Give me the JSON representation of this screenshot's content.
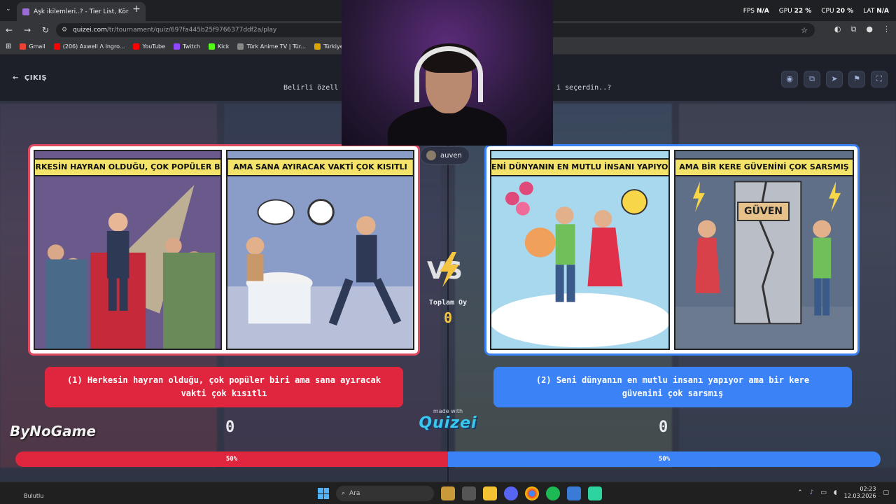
{
  "browser": {
    "tab_title": "Aşk ikilemleri..? - Tier List, Kör S",
    "tab_close": "✕",
    "new_tab": "+",
    "url_host": "quizei.com",
    "url_path": "/tr/tournament/quiz/697fa445b25f9766377ddf2a/play",
    "bookmarks": [
      "Gmail",
      "(206) Axwell Λ Ingro...",
      "YouTube",
      "Twitch",
      "Kick",
      "Türk Anime TV | Tür...",
      "Türkiye'nin"
    ],
    "hud": {
      "fps_label": "FPS",
      "fps": "N/A",
      "gpu_label": "GPU",
      "gpu": "22 %",
      "cpu_label": "CPU",
      "cpu": "20 %",
      "lat_label": "LAT",
      "lat": "N/A"
    }
  },
  "quiz": {
    "exit_label": "ÇIKIŞ",
    "question_left": "Belirli özell",
    "question_right": "i seçerdin..?",
    "user_name": "auven",
    "total_label": "Toplam Oy",
    "total_votes": "0",
    "made_with": "made with",
    "brand": "Quizei",
    "option_left": {
      "caption_1": "HERKESİN HAYRAN OLDUĞU, ÇOK POPÜLER BİRİ",
      "caption_2": "AMA SANA AYIRACAK VAKTİ ÇOK KISITLI",
      "label": "(1) Herkesin hayran olduğu, çok popüler biri ama sana ayıracak vakti çok kısıtlı",
      "votes": "0",
      "percent": 50,
      "percent_label": "50%"
    },
    "option_right": {
      "caption_1": "SENİ DÜNYANIN EN MUTLU İNSANI YAPIYOR",
      "caption_2": "AMA BİR KERE GÜVENİNİ ÇOK SARSMIŞ",
      "sign": "GÜVEN",
      "label": "(2) Seni dünyanın en mutlu insanı yapıyor ama bir kere güvenini çok sarsmış",
      "votes": "0",
      "percent": 50,
      "percent_label": "50%"
    },
    "colors": {
      "left": "#e0263f",
      "right": "#3b82f6",
      "accent": "#f5c542"
    }
  },
  "overlay": {
    "watermark": "ByNoGame"
  },
  "taskbar": {
    "weather": "Bulutlu",
    "search_placeholder": "Ara",
    "time": "02:23",
    "date": "12.03.2026"
  }
}
